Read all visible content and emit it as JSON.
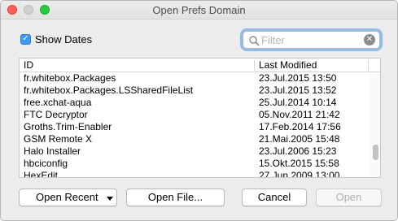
{
  "window": {
    "title": "Open Prefs Domain"
  },
  "options": {
    "show_dates_label": "Show Dates",
    "show_dates_checked": true
  },
  "search": {
    "placeholder": "Filter",
    "value": ""
  },
  "table": {
    "columns": [
      "ID",
      "Last Modified"
    ],
    "rows": [
      {
        "id": "fr.whitebox.Packages",
        "modified": "23.Jul.2015 13:50"
      },
      {
        "id": "fr.whitebox.Packages.LSSharedFileList",
        "modified": "23.Jul.2015 13:52"
      },
      {
        "id": "free.xchat-aqua",
        "modified": "25.Jul.2014 10:14"
      },
      {
        "id": "FTC Decryptor",
        "modified": "05.Nov.2011 21:42"
      },
      {
        "id": "Groths.Trim-Enabler",
        "modified": "17.Feb.2014 17:56"
      },
      {
        "id": "GSM Remote X",
        "modified": "21.Mai.2005 15:48"
      },
      {
        "id": "Halo Installer",
        "modified": "23.Jul.2006 15:23"
      },
      {
        "id": "hbciconfig",
        "modified": "15.Okt.2015 15:58"
      },
      {
        "id": "HexEdit",
        "modified": "27.Jun.2009 13:00"
      }
    ]
  },
  "buttons": {
    "open_recent": "Open Recent",
    "open_file": "Open File...",
    "cancel": "Cancel",
    "open": "Open"
  },
  "colors": {
    "accent": "#3b99fc",
    "close": "#ff5f57",
    "zoom": "#28c940"
  }
}
